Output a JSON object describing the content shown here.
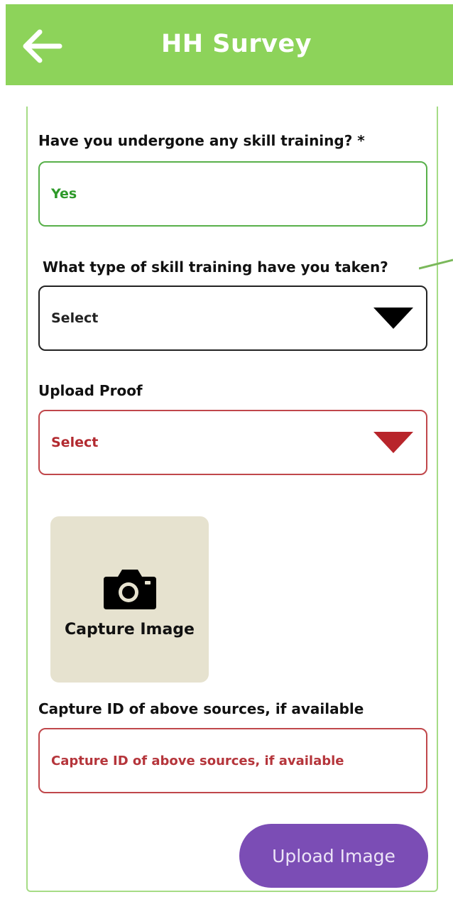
{
  "header": {
    "title": "HH Survey",
    "back_icon": "arrow-left-icon",
    "background_color": "#8dd35a"
  },
  "form": {
    "skill_training": {
      "label": "Have you undergone any skill training? *",
      "value": "Yes",
      "border_color": "#58b04a"
    },
    "training_type": {
      "label": "What type of skill training have you taken?",
      "value": "Select",
      "dropdown_icon": "caret-down-icon"
    },
    "upload_proof": {
      "label": "Upload Proof",
      "value": "Select",
      "dropdown_icon": "caret-down-icon",
      "border_color": "#c0474b"
    },
    "capture_image": {
      "label": "Capture Image",
      "icon": "camera-icon"
    },
    "capture_id": {
      "label": "Capture ID of above sources, if available",
      "placeholder": "Capture ID of above sources, if available"
    },
    "upload_button": {
      "label": "Upload Image",
      "color": "#7b4db5"
    }
  }
}
